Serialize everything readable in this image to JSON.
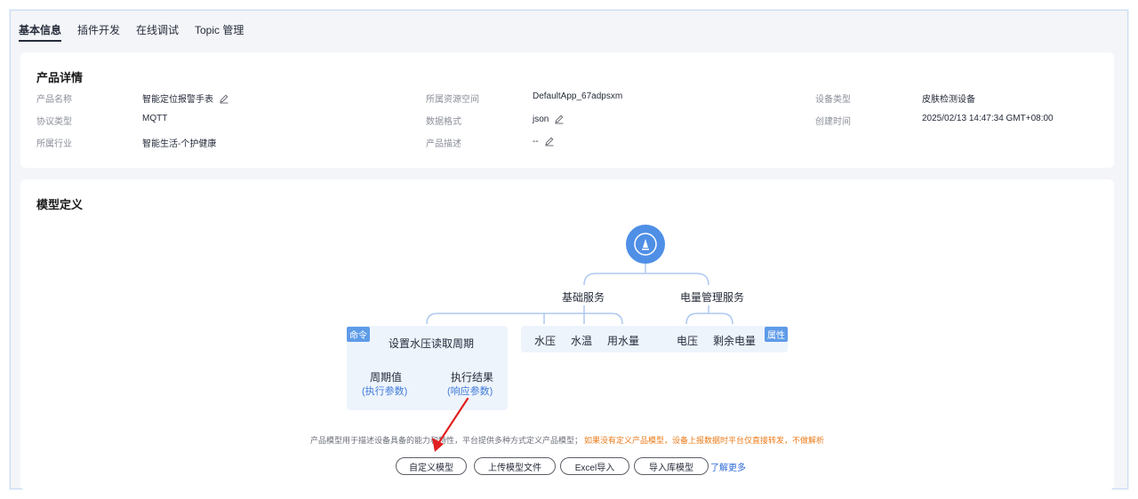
{
  "tabs": [
    {
      "label": "基本信息",
      "active": true
    },
    {
      "label": "插件开发",
      "active": false
    },
    {
      "label": "在线调试",
      "active": false
    },
    {
      "label": "Topic 管理",
      "active": false
    }
  ],
  "product_detail": {
    "title": "产品详情",
    "fields": {
      "name_label": "产品名称",
      "name_value": "智能定位报警手表",
      "protocol_label": "协议类型",
      "protocol_value": "MQTT",
      "industry_label": "所属行业",
      "industry_value": "智能生活-个护健康",
      "space_label": "所属资源空间",
      "space_value": "DefaultApp_67adpsxm",
      "format_label": "数据格式",
      "format_value": "json",
      "desc_label": "产品描述",
      "desc_value": "--",
      "device_type_label": "设备类型",
      "device_type_value": "皮肤检测设备",
      "created_label": "创建时间",
      "created_value": "2025/02/13 14:47:34 GMT+08:00"
    }
  },
  "model": {
    "title": "模型定义",
    "services": [
      "基础服务",
      "电量管理服务"
    ],
    "command_tag": "命令",
    "property_tag": "属性",
    "command_name": "设置水压读取周期",
    "command_params": [
      {
        "name": "周期值",
        "kind": "(执行参数)"
      },
      {
        "name": "执行结果",
        "kind": "(响应参数)"
      }
    ],
    "basic_properties": [
      "水压",
      "水温",
      "用水量"
    ],
    "power_properties": [
      "电压",
      "剩余电量"
    ],
    "description": "产品模型用于描述设备具备的能力和特性，平台提供多种方式定义产品模型；",
    "warning": "如果没有定义产品模型，设备上报数据时平台仅直接转发，不做解析",
    "buttons": {
      "custom": "自定义模型",
      "upload": "上传模型文件",
      "excel": "Excel导入",
      "library": "导入库模型"
    },
    "learn_more": "了解更多"
  },
  "colors": {
    "accent": "#4f8fe6",
    "annotation_arrow": "#e02020",
    "warning": "#ec7b1a"
  }
}
